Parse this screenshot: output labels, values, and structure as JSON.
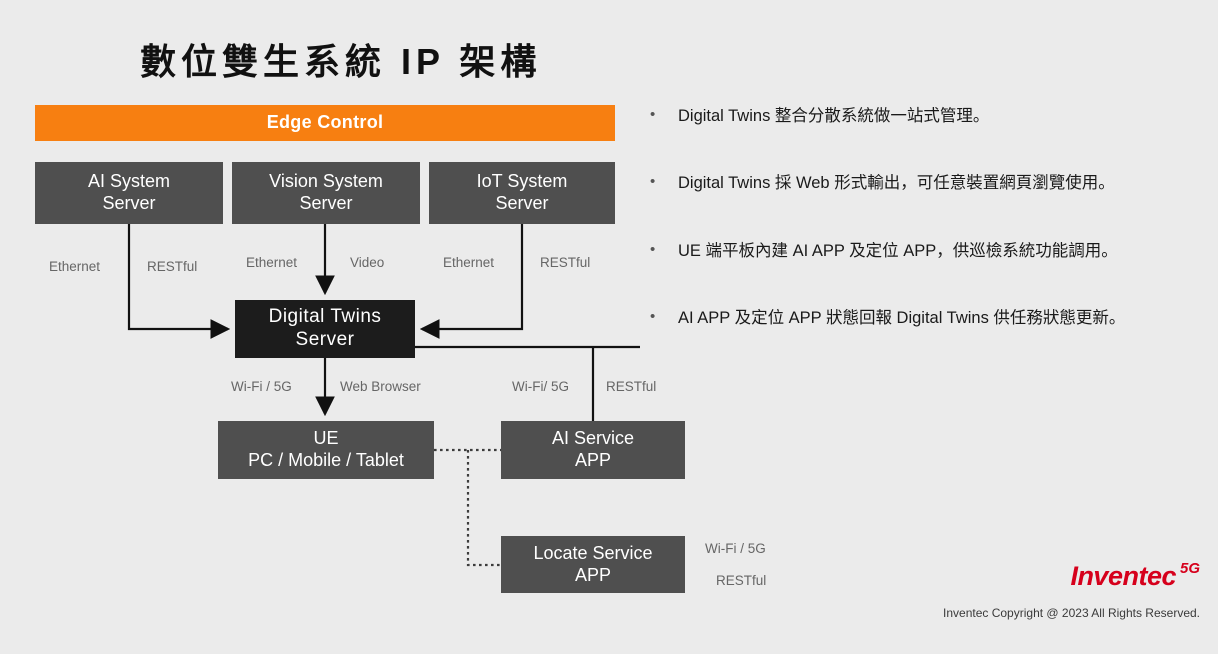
{
  "slide": {
    "title": "數位雙生系統 IP 架構",
    "background_color": "#ebebeb"
  },
  "diagram": {
    "edge_control": {
      "label": "Edge Control",
      "color": "#f77f11"
    },
    "boxes": {
      "ai_system_server": {
        "line1": "AI System",
        "line2": "Server",
        "color": "#4f4f4f"
      },
      "vision_system_server": {
        "line1": "Vision System",
        "line2": "Server",
        "color": "#4f4f4f"
      },
      "iot_system_server": {
        "line1": "IoT System",
        "line2": "Server",
        "color": "#4f4f4f"
      },
      "digital_twins_server": {
        "line1": "Digital Twins",
        "line2": "Server",
        "color": "#1c1c1c"
      },
      "ue": {
        "line1": "UE",
        "line2": "PC / Mobile / Tablet",
        "color": "#4f4f4f"
      },
      "ai_service_app": {
        "line1": "AI Service",
        "line2": "APP",
        "color": "#4f4f4f"
      },
      "locate_service_app": {
        "line1": "Locate Service",
        "line2": "APP",
        "color": "#4f4f4f"
      }
    },
    "wire_labels": {
      "ethernet_1": "Ethernet",
      "restful_1": "RESTful",
      "ethernet_2": "Ethernet",
      "video": "Video",
      "ethernet_3": "Ethernet",
      "restful_2": "RESTful",
      "wifi5g_1": "Wi-Fi / 5G",
      "web_browser": "Web Browser",
      "wifi5g_2": "Wi-Fi/ 5G",
      "restful_3": "RESTful",
      "wifi5g_3": "Wi-Fi / 5G",
      "restful_4": "RESTful"
    }
  },
  "bullets": [
    {
      "marker": "•",
      "text": "Digital Twins 整合分散系統做一站式管理。"
    },
    {
      "marker": "•",
      "text": "Digital Twins 採 Web 形式輸出，可任意裝置網頁瀏覽使用。"
    },
    {
      "marker": "•",
      "text": "UE 端平板內建 AI APP 及定位 APP，供巡檢系統功能調用。"
    },
    {
      "marker": "•",
      "text": "AI APP 及定位 APP 狀態回報 Digital Twins 供任務狀態更新。"
    }
  ],
  "footer": {
    "logo_word": "Inventec",
    "logo_badge": "5G",
    "logo_color": "#d6001c",
    "copyright": "Inventec Copyright @ 2023 All Rights Reserved."
  }
}
